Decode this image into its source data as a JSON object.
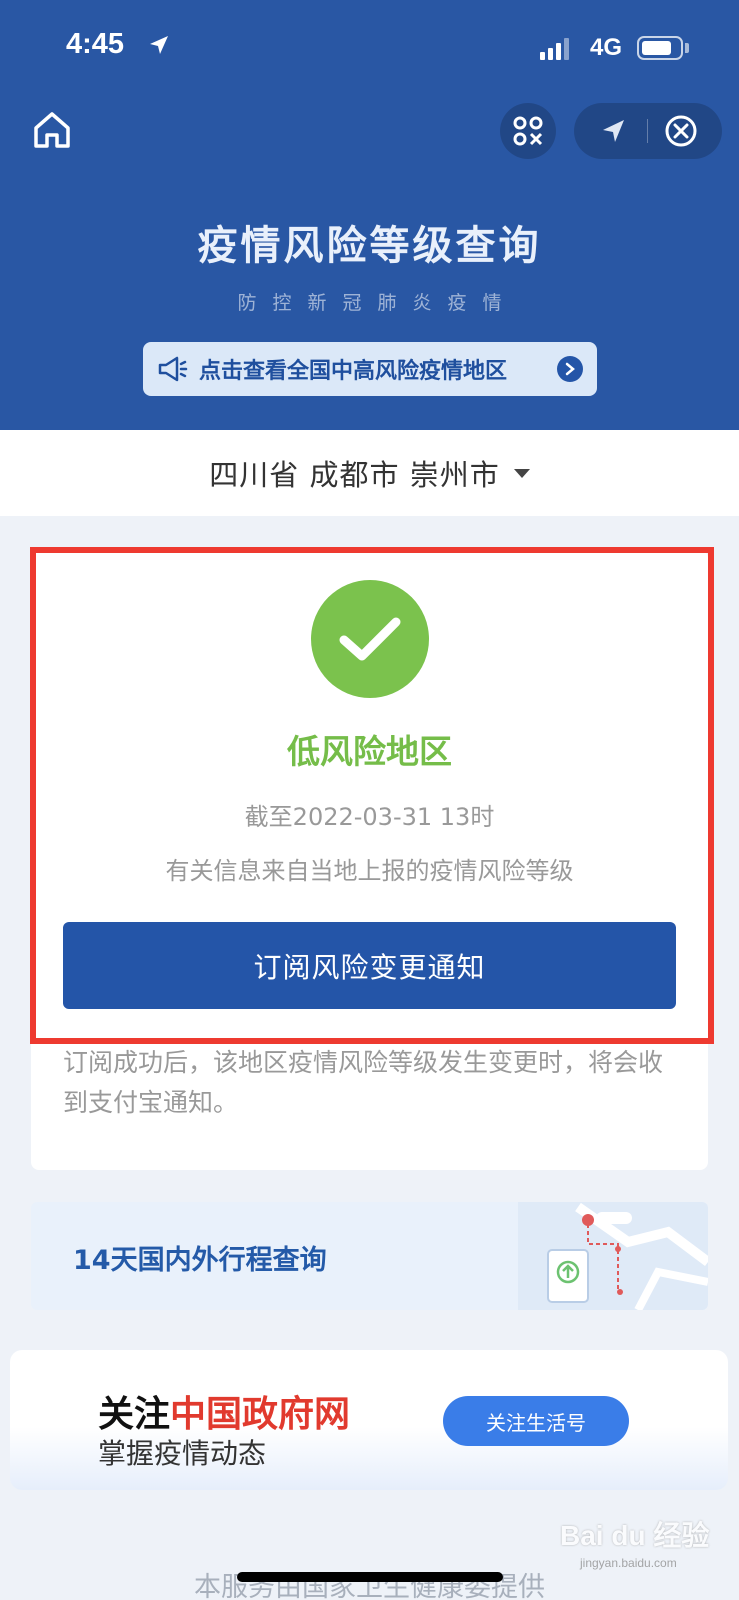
{
  "status_bar": {
    "time": "4:45",
    "network": "4G",
    "battery_level": 0.8
  },
  "header": {
    "title": "疫情风险等级查询",
    "subtitle": "防控新冠肺炎疫情",
    "notice": "点击查看全国中高风险疫情地区",
    "color": "#2957a4"
  },
  "region": {
    "label": "四川省 成都市 崇州市"
  },
  "risk": {
    "level": "低风险地区",
    "date": "截至2022-03-31 13时",
    "source": "有关信息来自当地上报的疫情风险等级",
    "subscribe_label": "订阅风险变更通知",
    "note": "订阅成功后，该地区疫情风险等级发生变更时，将会收到支付宝通知。",
    "level_color": "#75bd49",
    "highlight_color": "#ee3a30"
  },
  "trip": {
    "label": "14天国内外行程查询"
  },
  "follow": {
    "title_prefix": "关注",
    "title_highlight": "中国政府网",
    "subtitle": "掌握疫情动态",
    "button_label": "关注生活号"
  },
  "footer": {
    "text": "本服务由国家卫生健康委提供"
  },
  "watermark": {
    "main": "Bai du 经验",
    "sub": "jingyan.baidu.com"
  }
}
